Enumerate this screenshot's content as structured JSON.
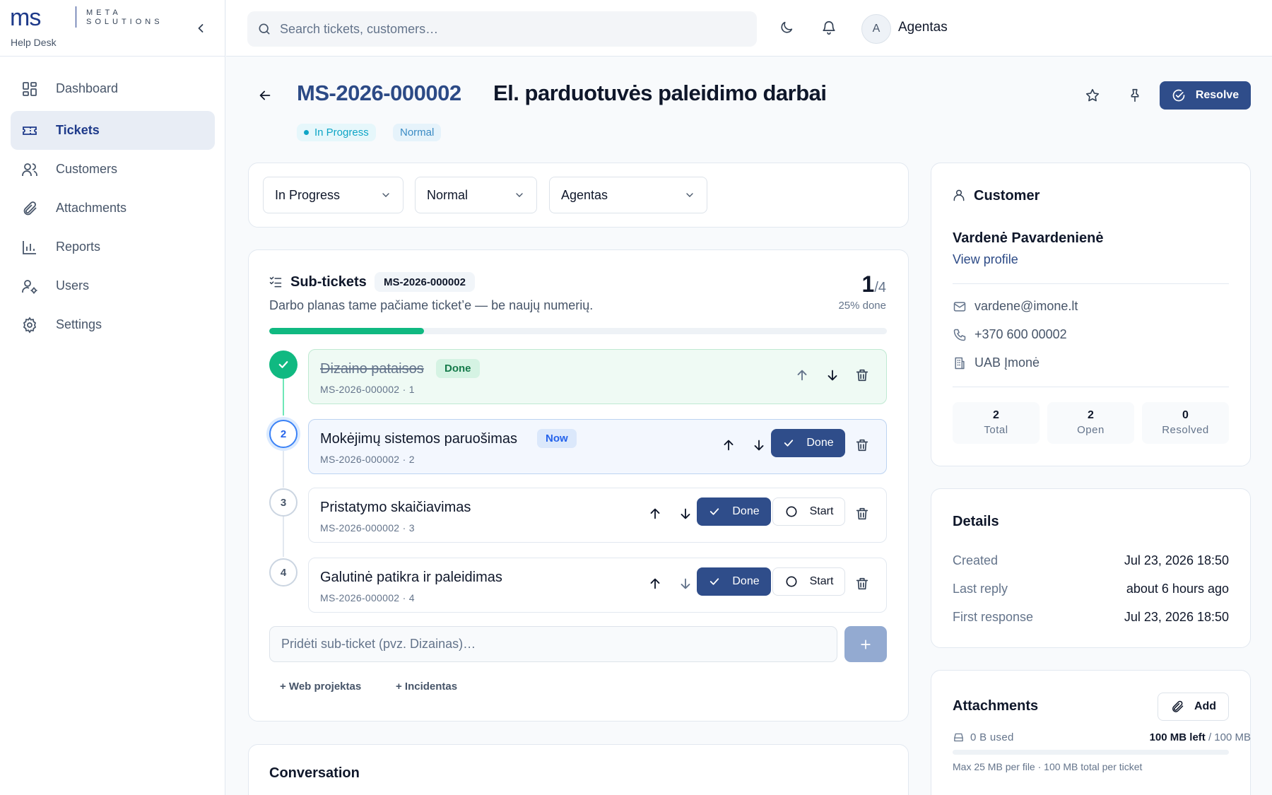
{
  "brand": {
    "logo_mark": "ms",
    "logo_line1": "META",
    "logo_line2": "SOLUTIONS",
    "subtitle": "Help Desk"
  },
  "sidebar": {
    "items": [
      {
        "label": "Dashboard",
        "icon": "dashboard-icon"
      },
      {
        "label": "Tickets",
        "icon": "ticket-icon",
        "active": true
      },
      {
        "label": "Customers",
        "icon": "users-icon"
      },
      {
        "label": "Attachments",
        "icon": "paperclip-icon"
      },
      {
        "label": "Reports",
        "icon": "bar-chart-icon"
      },
      {
        "label": "Users",
        "icon": "user-cog-icon"
      },
      {
        "label": "Settings",
        "icon": "gear-icon"
      }
    ]
  },
  "header": {
    "search_placeholder": "Search tickets, customers…",
    "avatar_initial": "A",
    "user_name": "Agentas"
  },
  "ticket": {
    "id": "MS-2026-000002",
    "title": "El. parduotuvės paleidimo darbai",
    "status": "In Progress",
    "priority": "Normal",
    "resolve_label": "Resolve"
  },
  "controls": {
    "status": "In Progress",
    "priority": "Normal",
    "assignee": "Agentas"
  },
  "subtickets": {
    "title": "Sub-tickets",
    "ref": "MS-2026-000002",
    "description": "Darbo planas tame pačiame ticket’e — be naujų numerių.",
    "done": "1",
    "total": "/4",
    "percent_label": "25% done",
    "progress": 0.25,
    "items": [
      {
        "num": "1",
        "name": "Dizaino pataisos",
        "ref": "MS-2026-000002 · 1",
        "state": "done",
        "tag": "Done"
      },
      {
        "num": "2",
        "name": "Mokėjimų sistemos paruošimas",
        "ref": "MS-2026-000002 · 2",
        "state": "now",
        "tag": "Now",
        "done_label": "Done"
      },
      {
        "num": "3",
        "name": "Pristatymo skaičiavimas",
        "ref": "MS-2026-000002 · 3",
        "state": "todo",
        "done_label": "Done",
        "start_label": "Start"
      },
      {
        "num": "4",
        "name": "Galutinė patikra ir paleidimas",
        "ref": "MS-2026-000002 · 4",
        "state": "todo",
        "done_label": "Done",
        "start_label": "Start"
      }
    ],
    "add_placeholder": "Pridėti sub-ticket (pvz. Dizainas)…",
    "templates": [
      "+ Web projektas",
      "+ Incidentas"
    ]
  },
  "conversation": {
    "title": "Conversation"
  },
  "customer": {
    "heading": "Customer",
    "name": "Vardenė Pavardenienė",
    "view_profile": "View profile",
    "email": "vardene@imone.lt",
    "phone": "+370 600 00002",
    "company": "UAB Įmonė",
    "stats": [
      {
        "num": "2",
        "label": "Total"
      },
      {
        "num": "2",
        "label": "Open"
      },
      {
        "num": "0",
        "label": "Resolved"
      }
    ]
  },
  "details": {
    "heading": "Details",
    "rows": [
      {
        "k": "Created",
        "v": "Jul 23, 2026 18:50"
      },
      {
        "k": "Last reply",
        "v": "about 6 hours ago"
      },
      {
        "k": "First response",
        "v": "Jul 23, 2026 18:50"
      }
    ]
  },
  "attachments": {
    "heading": "Attachments",
    "add_label": "Add",
    "used": "0 B used",
    "left": "100 MB left",
    "limit": "/ 100 MB",
    "note": "Max 25 MB per file · 100 MB total per ticket"
  },
  "colors": {
    "primary": "#2f4d8a",
    "success": "#10b981",
    "status": "#0ea5c6"
  }
}
